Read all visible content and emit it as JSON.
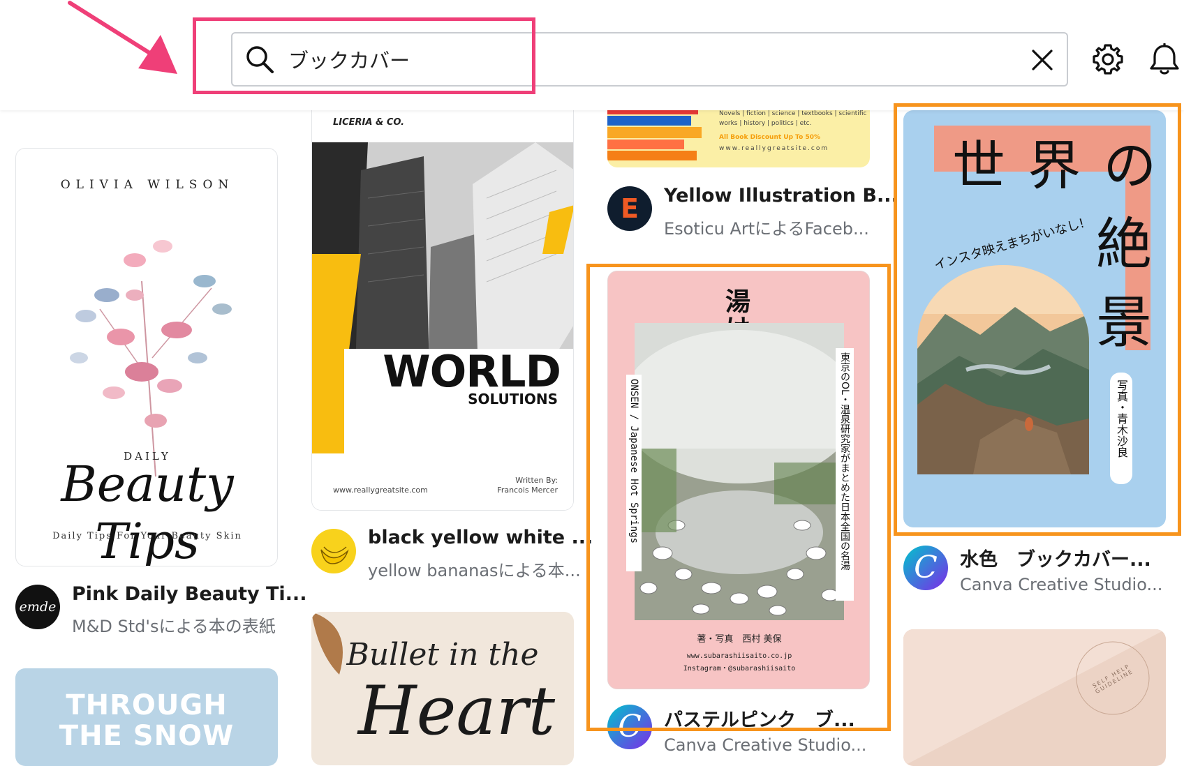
{
  "search": {
    "query": "ブックカバー"
  },
  "templates": [
    {
      "title": "Pink Daily Beauty Ti...",
      "creator": "M&D Std'sによる本の表紙",
      "avatar_text": "emde",
      "cover": {
        "author": "OLIVIA WILSON",
        "kicker": "DAILY",
        "script": "Beauty Tips",
        "tagline": "Daily Tips For Your Beauty Skin"
      }
    },
    {
      "title": "black yellow white ...",
      "creator": "yellow bananasによる本...",
      "cover": {
        "brand": "LICERIA & CO.",
        "headline": "WORLD",
        "subheadline": "SOLUTIONS",
        "site": "www.reallygreatsite.com",
        "written_by": "Written By:",
        "author": "Francois Mercer"
      }
    },
    {
      "title": "Yellow Illustration B...",
      "creator": "Esoticu ArtによるFaceb...",
      "cover": {
        "line1": "Novels | fiction | science | textbooks | scientific",
        "line2": "works | history | politics | etc.",
        "discount": "All Book Discount Up To 50%",
        "site": "www.reallygreatsite.com"
      }
    },
    {
      "title": "パステルピンク　ブ...",
      "creator": "Canva Creative Studio...",
      "cover": {
        "title": "湯けむり道楽",
        "left_vertical": "ONSEN / Japanese Hot Springs",
        "right_vertical": "東京のOL・温泉研究家がまとめた日本全国の名湯",
        "credit": "著・写真　西村 美保",
        "site": "www.subarashiisaito.co.jp",
        "instagram": "Instagram・@subarashiisaito"
      }
    },
    {
      "title": "水色　ブックカバー...",
      "creator": "Canva Creative Studio...",
      "cover": {
        "title_top": "世 界 の",
        "title_2": "絶",
        "title_3": "景",
        "arc_text": "インスタ映えまちがいなし!",
        "credit": "写真・青木沙良"
      }
    },
    {
      "cover": {
        "headline_1": "THROUGH",
        "headline_2": "THE SNOW"
      }
    },
    {
      "cover": {
        "script_1": "Bullet in the",
        "script_2": "Heart"
      }
    },
    {
      "cover": {
        "seal_text": "SELF HELP GUIDELINE"
      }
    }
  ],
  "colors": {
    "annotation_pink": "#ef3f78",
    "annotation_orange": "#f7941d",
    "canva_gradient_start": "#00c4cc",
    "canva_gradient_end": "#7d2ae8"
  }
}
